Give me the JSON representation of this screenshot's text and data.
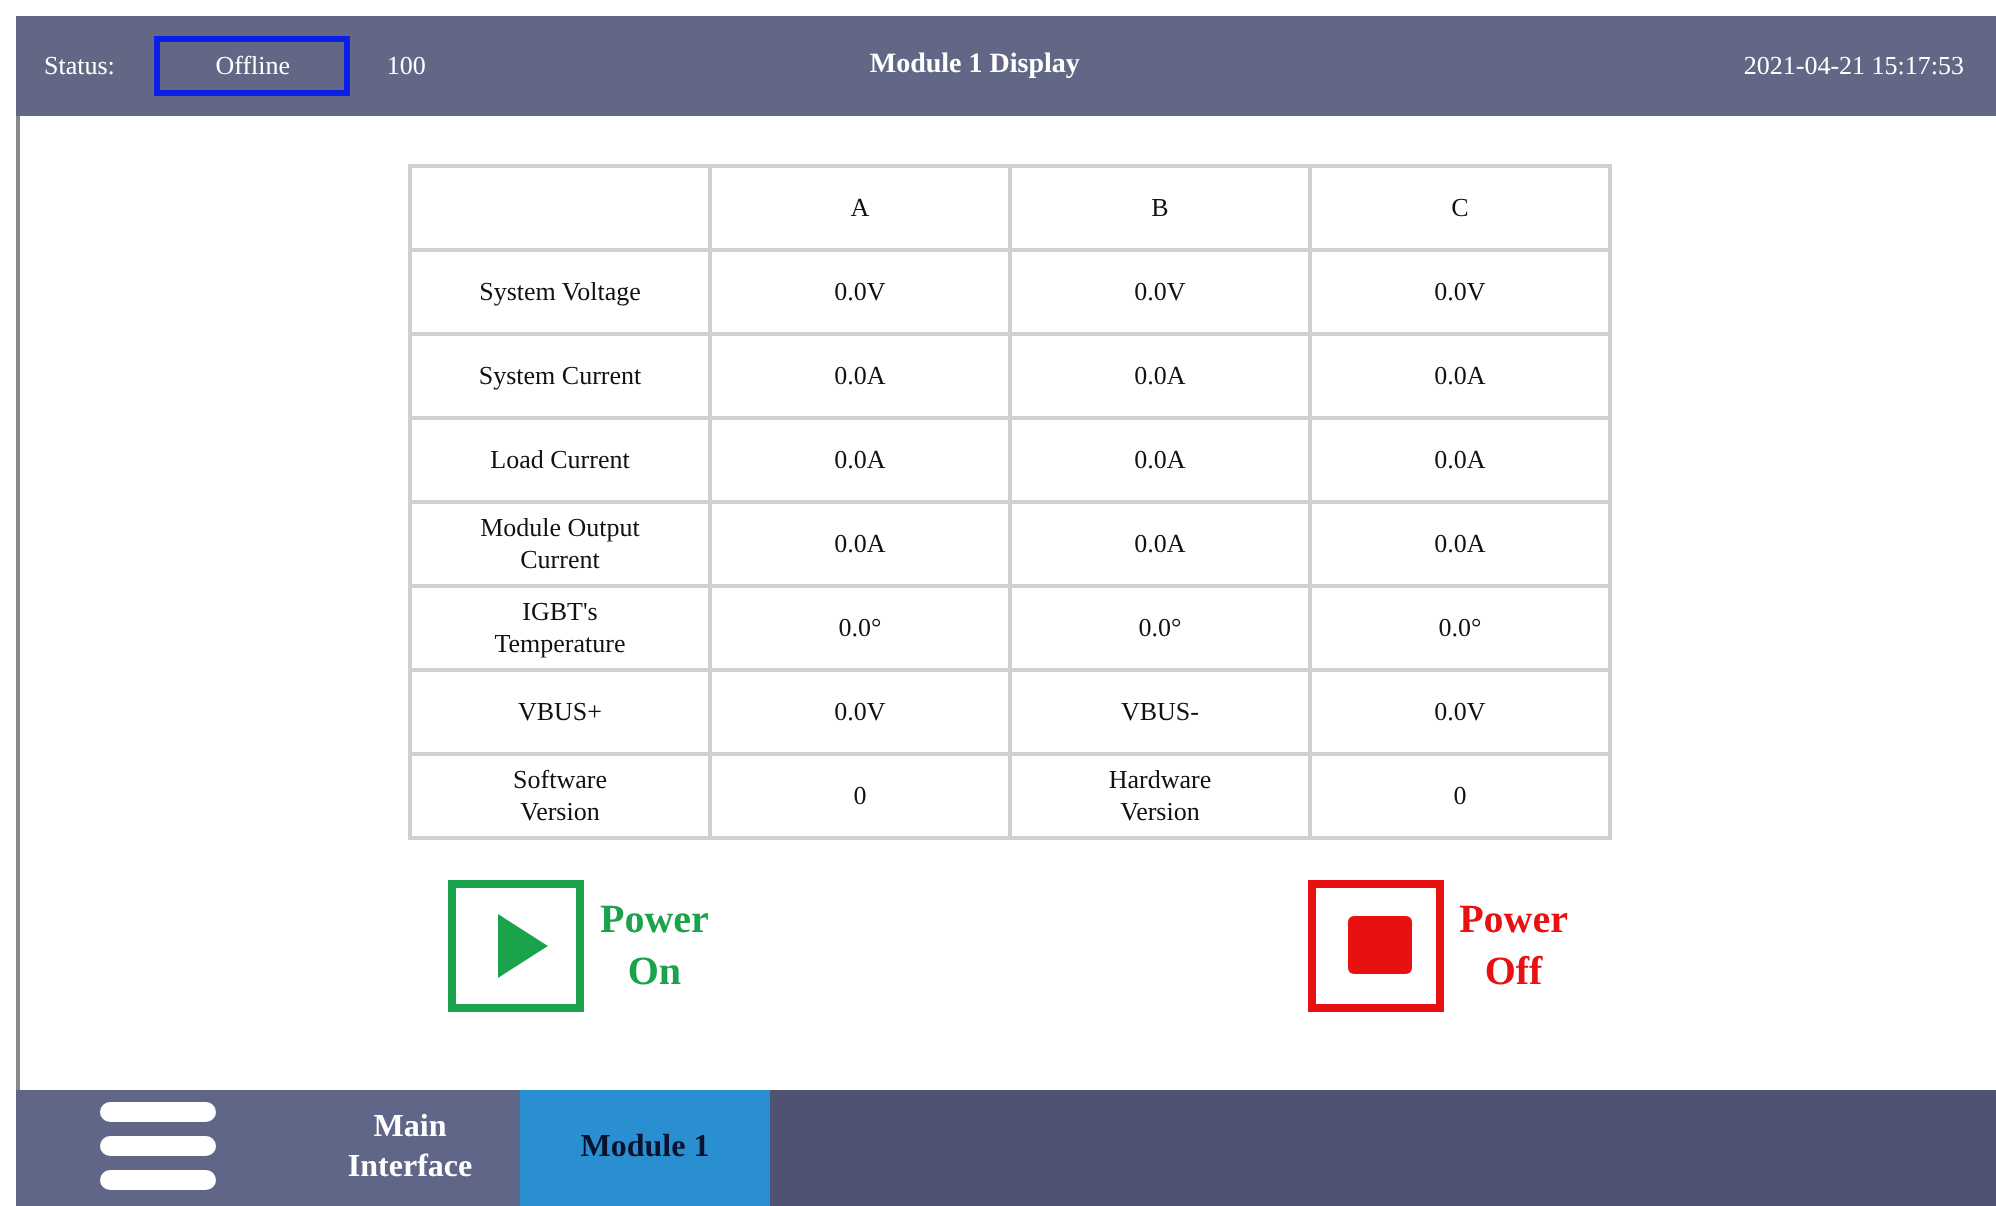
{
  "header": {
    "status_label": "Status:",
    "status_value": "Offline",
    "code": "100",
    "title": "Module 1 Display",
    "datetime": "2021-04-21 15:17:53"
  },
  "table": {
    "columns": [
      "",
      "A",
      "B",
      "C"
    ],
    "rows": [
      [
        "System Voltage",
        "0.0V",
        "0.0V",
        "0.0V"
      ],
      [
        "System Current",
        "0.0A",
        "0.0A",
        "0.0A"
      ],
      [
        "Load Current",
        "0.0A",
        "0.0A",
        "0.0A"
      ],
      [
        "Module Output\nCurrent",
        "0.0A",
        "0.0A",
        "0.0A"
      ],
      [
        "IGBT's\nTemperature",
        "0.0°",
        "0.0°",
        "0.0°"
      ],
      [
        "VBUS+",
        "0.0V",
        "VBUS-",
        "0.0V"
      ],
      [
        "Software\nVersion",
        "0",
        "Hardware\nVersion",
        "0"
      ]
    ]
  },
  "buttons": [
    {
      "kind": "on",
      "label": "Power\nOn"
    },
    {
      "kind": "off",
      "label": "Power\nOff"
    }
  ],
  "tabs": [
    {
      "label": "Main\nInterface",
      "selected": false
    },
    {
      "label": "Module 1",
      "selected": true
    }
  ]
}
